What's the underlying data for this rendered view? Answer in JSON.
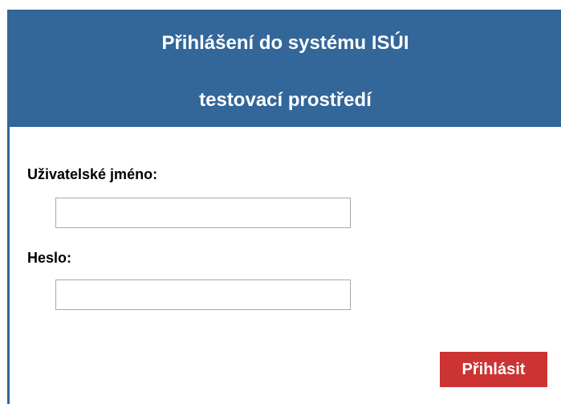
{
  "header": {
    "title_line1": "Přihlášení do systému ISÚI",
    "title_line2": "testovací prostředí"
  },
  "form": {
    "username_label": "Uživatelské jméno:",
    "username_value": "",
    "password_label": "Heslo:",
    "password_value": "",
    "submit_label": "Přihlásit"
  },
  "colors": {
    "header_background": "#336699",
    "button_background": "#cc3333",
    "input_border": "#a9a9a9"
  }
}
